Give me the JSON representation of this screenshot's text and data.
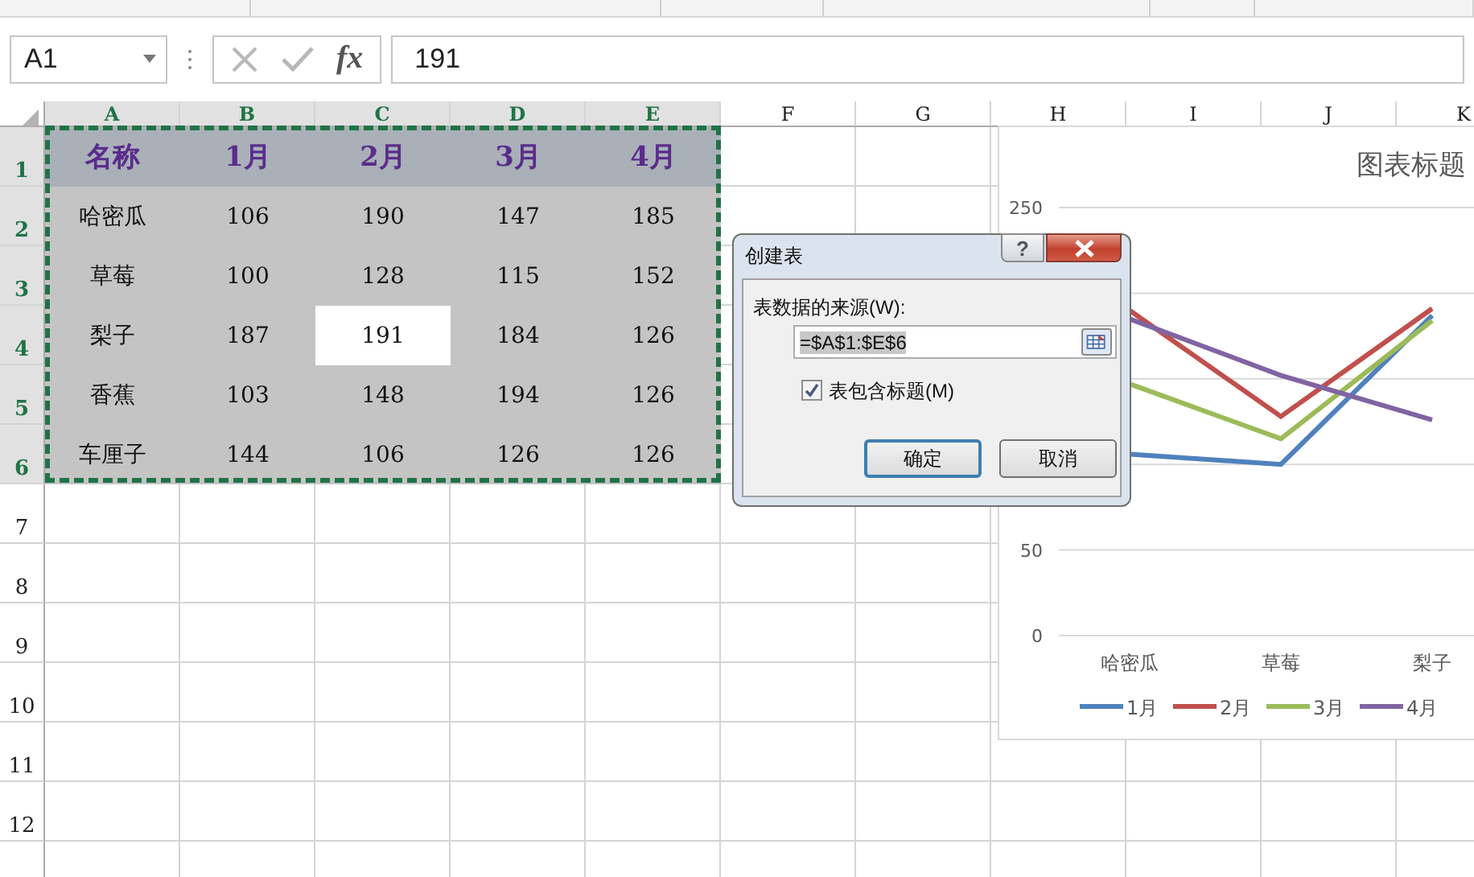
{
  "formula_bar": {
    "name_box": "A1",
    "fx": "fx",
    "content": "191"
  },
  "columns": [
    {
      "label": "A",
      "selected": true
    },
    {
      "label": "B",
      "selected": true
    },
    {
      "label": "C",
      "selected": true
    },
    {
      "label": "D",
      "selected": true
    },
    {
      "label": "E",
      "selected": true
    },
    {
      "label": "F",
      "selected": false
    },
    {
      "label": "G",
      "selected": false
    },
    {
      "label": "H",
      "selected": false
    },
    {
      "label": "I",
      "selected": false
    },
    {
      "label": "J",
      "selected": false
    },
    {
      "label": "K",
      "selected": false
    }
  ],
  "rows": [
    {
      "label": "1",
      "selected": true,
      "kind": "header",
      "cells": [
        {
          "text": "名称",
          "active": false
        },
        {
          "text": "1月",
          "active": false
        },
        {
          "text": "2月",
          "active": false
        },
        {
          "text": "3月",
          "active": false
        },
        {
          "text": "4月",
          "active": false
        }
      ]
    },
    {
      "label": "2",
      "selected": true,
      "kind": "data",
      "cells": [
        {
          "text": "哈密瓜",
          "active": false
        },
        {
          "text": "106",
          "active": false
        },
        {
          "text": "190",
          "active": false
        },
        {
          "text": "147",
          "active": false
        },
        {
          "text": "185",
          "active": false
        }
      ]
    },
    {
      "label": "3",
      "selected": true,
      "kind": "data",
      "cells": [
        {
          "text": "草莓",
          "active": false
        },
        {
          "text": "100",
          "active": false
        },
        {
          "text": "128",
          "active": false
        },
        {
          "text": "115",
          "active": false
        },
        {
          "text": "152",
          "active": false
        }
      ]
    },
    {
      "label": "4",
      "selected": true,
      "kind": "data",
      "cells": [
        {
          "text": "梨子",
          "active": false
        },
        {
          "text": "187",
          "active": false
        },
        {
          "text": "191",
          "active": true
        },
        {
          "text": "184",
          "active": false
        },
        {
          "text": "126",
          "active": false
        }
      ]
    },
    {
      "label": "5",
      "selected": true,
      "kind": "data",
      "cells": [
        {
          "text": "香蕉",
          "active": false
        },
        {
          "text": "103",
          "active": false
        },
        {
          "text": "148",
          "active": false
        },
        {
          "text": "194",
          "active": false
        },
        {
          "text": "126",
          "active": false
        }
      ]
    },
    {
      "label": "6",
      "selected": true,
      "kind": "data",
      "cells": [
        {
          "text": "车厘子",
          "active": false
        },
        {
          "text": "144",
          "active": false
        },
        {
          "text": "106",
          "active": false
        },
        {
          "text": "126",
          "active": false
        },
        {
          "text": "126",
          "active": false
        }
      ]
    },
    {
      "label": "7",
      "selected": false,
      "kind": "empty"
    },
    {
      "label": "8",
      "selected": false,
      "kind": "empty"
    },
    {
      "label": "9",
      "selected": false,
      "kind": "empty"
    },
    {
      "label": "10",
      "selected": false,
      "kind": "empty"
    },
    {
      "label": "11",
      "selected": false,
      "kind": "empty"
    },
    {
      "label": "12",
      "selected": false,
      "kind": "empty"
    }
  ],
  "chart": {
    "chart_data": {
      "type": "line",
      "title": "图表标题",
      "legend": "bottom",
      "categories": [
        "哈密瓜",
        "草莓",
        "梨子"
      ],
      "ylim": [
        0,
        250
      ],
      "yticks": [
        0,
        50,
        250
      ],
      "series": [
        {
          "name": "1月",
          "color": "#4f81bd",
          "values": [
            106,
            100,
            187
          ]
        },
        {
          "name": "2月",
          "color": "#c0504d",
          "values": [
            190,
            128,
            191
          ]
        },
        {
          "name": "3月",
          "color": "#9bbb59",
          "values": [
            147,
            115,
            184
          ]
        },
        {
          "name": "4月",
          "color": "#8064a2",
          "values": [
            185,
            152,
            126
          ]
        }
      ]
    }
  },
  "dialog": {
    "title": "创建表",
    "help": "?",
    "source_label": "表数据的来源(W):",
    "source_value": "=$A$1:$E$6",
    "has_headers": {
      "label": "表包含标题(M)",
      "checked": true
    },
    "buttons": [
      {
        "label": "确定",
        "default": true
      },
      {
        "label": "取消",
        "default": false
      }
    ]
  }
}
